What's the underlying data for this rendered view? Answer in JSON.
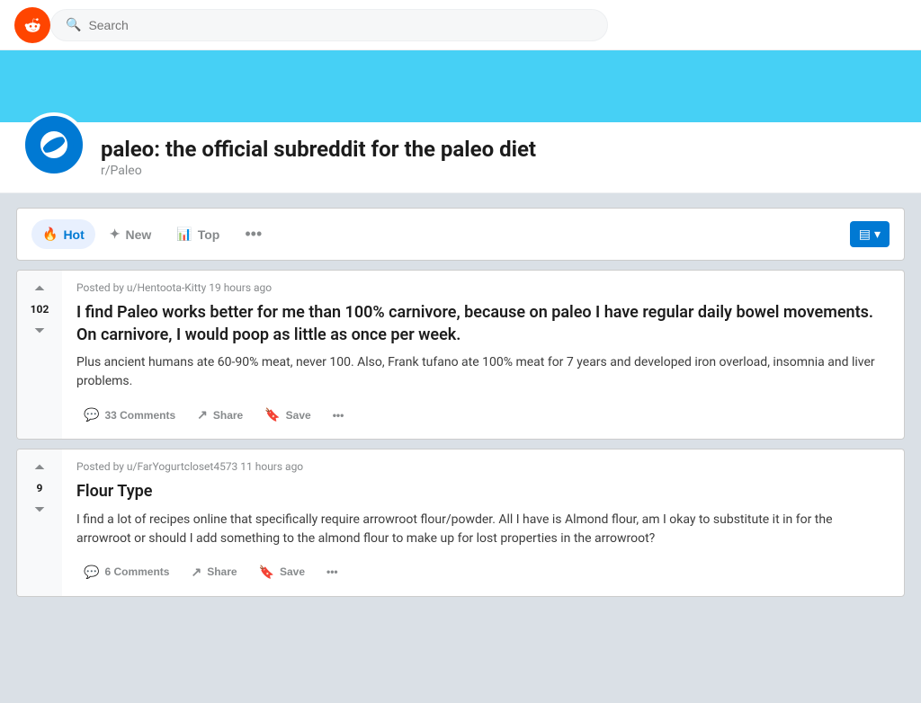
{
  "header": {
    "search_placeholder": "Search"
  },
  "banner": {
    "color": "#46d0f5"
  },
  "subreddit": {
    "title": "paleo: the official subreddit for the paleo diet",
    "sub_name": "r/Paleo"
  },
  "sort_bar": {
    "hot_label": "Hot",
    "new_label": "New",
    "top_label": "Top",
    "more_label": "•••",
    "layout_label": "▤ ▾"
  },
  "posts": [
    {
      "meta": "Posted by u/Hentoota-Kitty 19 hours ago",
      "username": "u/Hentoota-Kitty",
      "time": "19 hours ago",
      "vote_count": "102",
      "title": "I find Paleo works better for me than 100% carnivore, because on paleo I have regular daily bowel movements. On carnivore, I would poop as little as once per week.",
      "body": "Plus ancient humans ate 60-90% meat, never 100. Also, Frank tufano ate 100% meat for 7 years and developed iron overload, insomnia and liver problems.",
      "comments_label": "33 Comments",
      "share_label": "Share",
      "save_label": "Save",
      "more_label": "•••"
    },
    {
      "meta": "Posted by u/FarYogurtcloset4573 11 hours ago",
      "username": "u/FarYogurtcloset4573",
      "time": "11 hours ago",
      "vote_count": "9",
      "title": "Flour Type",
      "body": "I find a lot of recipes online that specifically require arrowroot flour/powder. All I have is Almond flour, am I okay to substitute it in for the arrowroot or should I add something to the almond flour to make up for lost properties in the arrowroot?",
      "comments_label": "6 Comments",
      "share_label": "Share",
      "save_label": "Save",
      "more_label": "•••"
    }
  ]
}
